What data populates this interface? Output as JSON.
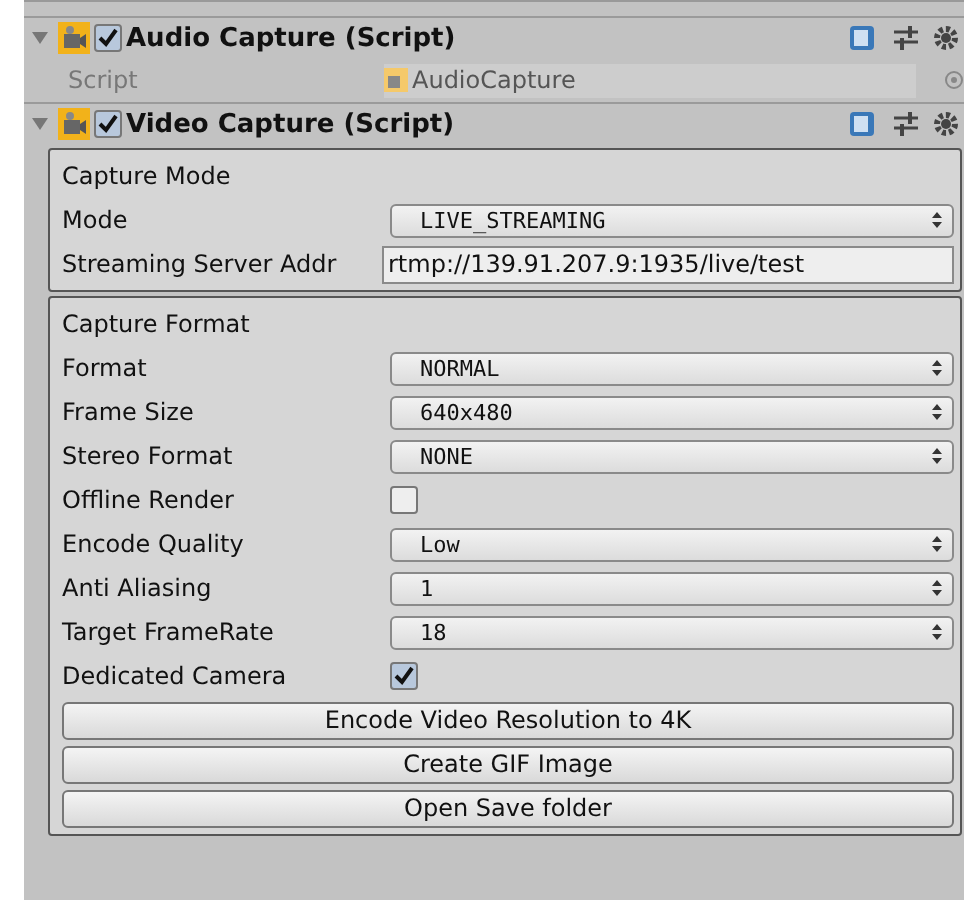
{
  "components": [
    {
      "title": "Audio Capture (Script)",
      "enabled": true,
      "expanded": true,
      "fields": [
        {
          "kind": "script",
          "label": "Script",
          "value": "AudioCapture",
          "disabled": true
        }
      ]
    },
    {
      "title": "Video Capture (Script)",
      "enabled": true,
      "expanded": true,
      "sections": [
        {
          "heading": "Capture Mode",
          "rows": [
            {
              "kind": "dropdown",
              "label": "Mode",
              "value": "LIVE_STREAMING"
            },
            {
              "kind": "text",
              "label": "Streaming Server Addr",
              "value": "rtmp://139.91.207.9:1935/live/test"
            }
          ]
        },
        {
          "heading": "Capture Format",
          "rows": [
            {
              "kind": "dropdown",
              "label": "Format",
              "value": "NORMAL"
            },
            {
              "kind": "dropdown",
              "label": "Frame Size",
              "value": "640x480"
            },
            {
              "kind": "dropdown",
              "label": "Stereo Format",
              "value": "NONE"
            },
            {
              "kind": "checkbox",
              "label": "Offline Render",
              "checked": false
            },
            {
              "kind": "dropdown",
              "label": "Encode Quality",
              "value": "Low"
            },
            {
              "kind": "dropdown",
              "label": "Anti Aliasing",
              "value": "1"
            },
            {
              "kind": "dropdown",
              "label": "Target FrameRate",
              "value": "18"
            },
            {
              "kind": "checkbox",
              "label": "Dedicated Camera",
              "checked": true
            },
            {
              "kind": "button",
              "label": "Encode Video Resolution to 4K"
            },
            {
              "kind": "button",
              "label": "Create GIF Image"
            },
            {
              "kind": "button",
              "label": "Open Save folder"
            }
          ]
        }
      ]
    }
  ]
}
